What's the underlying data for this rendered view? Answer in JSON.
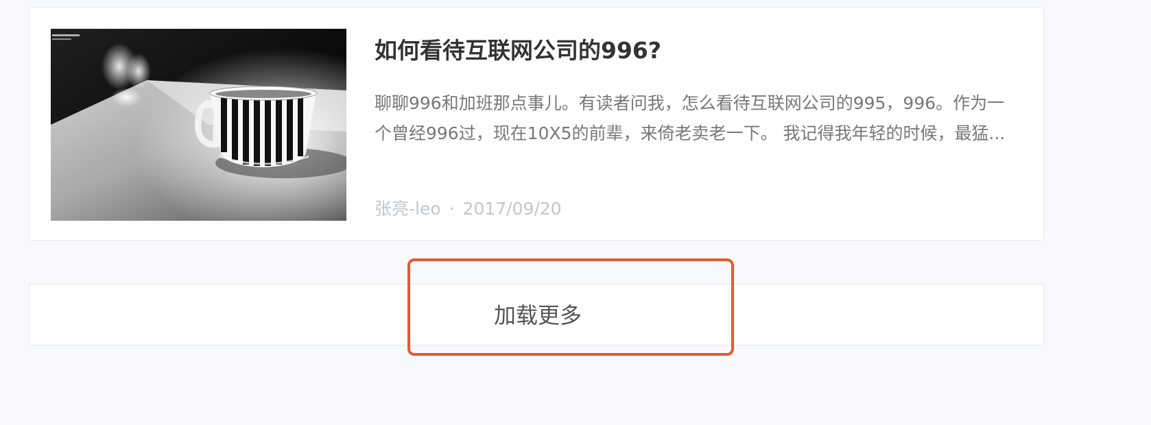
{
  "article": {
    "title": "如何看待互联网公司的996?",
    "summary": "聊聊996和加班那点事儿。有读者问我，怎么看待互联网公司的995，996。作为一个曾经996过，现在10X5的前辈，来倚老卖老一下。 我记得我年轻的时候，最猛...",
    "author": "张亮-leo",
    "separator": "·",
    "date": "2017/09/20",
    "thumbnail": "black-and-white photo of a striped coffee cup on a table"
  },
  "load_more": {
    "label": "加载更多"
  },
  "colors": {
    "page_background": "#f8f9fc",
    "card_background": "#ffffff",
    "title": "#333333",
    "summary": "#777777",
    "meta": "#c2c6cc",
    "highlight_border": "#e8582e"
  }
}
